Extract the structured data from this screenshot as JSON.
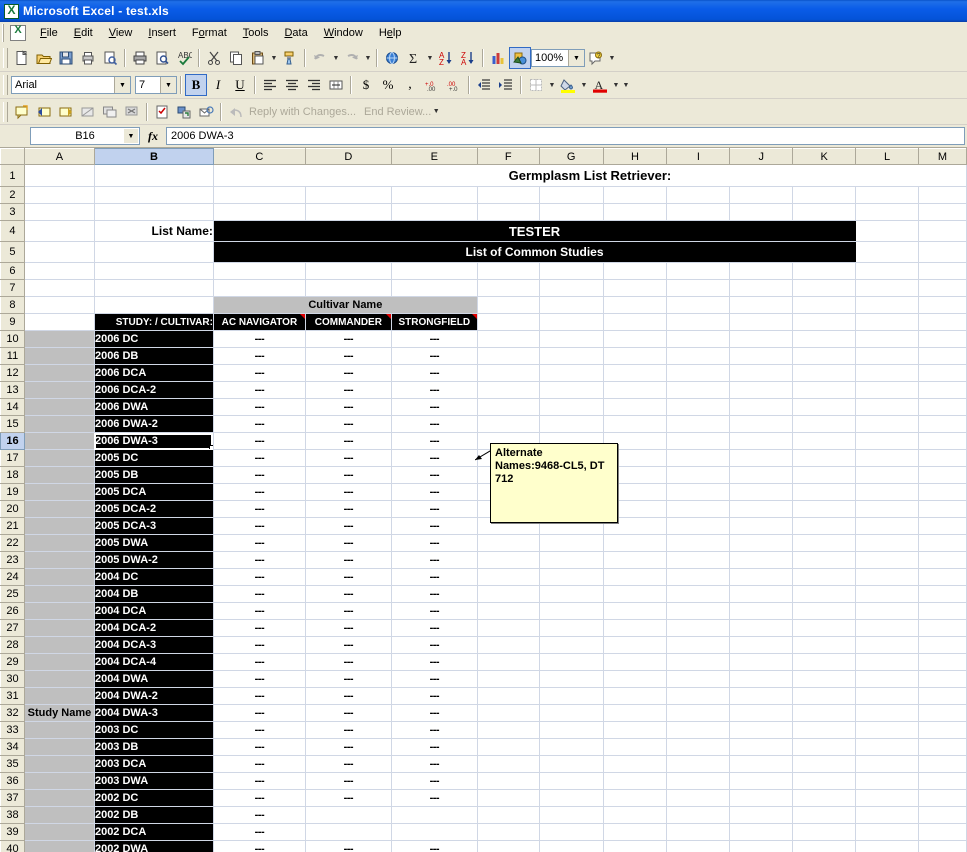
{
  "window": {
    "title": "Microsoft Excel - test.xls",
    "app_icon": "excel-icon"
  },
  "menu": {
    "items": [
      {
        "label": "File"
      },
      {
        "label": "Edit"
      },
      {
        "label": "View"
      },
      {
        "label": "Insert"
      },
      {
        "label": "Format"
      },
      {
        "label": "Tools"
      },
      {
        "label": "Data"
      },
      {
        "label": "Window"
      },
      {
        "label": "Help"
      }
    ]
  },
  "standard_toolbar": {
    "icons": [
      "new-icon",
      "open-icon",
      "save-icon",
      "print-icon",
      "print-preview-search-icon",
      "print2-icon",
      "preview-icon",
      "spelling-icon",
      "cut-icon",
      "copy-icon",
      "paste-icon",
      "format-painter-icon",
      "undo-icon",
      "redo-icon",
      "hyperlink-icon",
      "autosum-icon",
      "sort-asc-icon",
      "sort-desc-icon",
      "chart-wizard-icon",
      "drawing-icon",
      "help-icon"
    ],
    "zoom_value": "100%"
  },
  "formatting_toolbar": {
    "font_name": "Arial",
    "font_size": "7",
    "bold_label": "B",
    "italic_label": "I",
    "underline_label": "U",
    "icons": [
      "align-left-icon",
      "align-center-icon",
      "align-right-icon",
      "merge-center-icon",
      "currency-icon",
      "percent-icon",
      "comma-icon",
      "increase-decimal-icon",
      "decrease-decimal-icon",
      "decrease-indent-icon",
      "increase-indent-icon",
      "borders-icon",
      "fill-color-icon",
      "font-color-icon"
    ],
    "currency_label": "$",
    "percent_label": "%",
    "comma_label": ","
  },
  "reviewing_toolbar": {
    "icons": [
      "new-comment-icon",
      "previous-comment-icon",
      "next-comment-icon",
      "hide-comment-icon",
      "show-all-comments-icon",
      "delete-comment-icon",
      "create-task-icon",
      "update-file-icon",
      "send-to-mail-icon",
      "reply-icon"
    ],
    "reply_label": "Reply with Changes...",
    "end_review_label": "End Review..."
  },
  "formula_bar": {
    "name_box": "B16",
    "fx_label": "fx",
    "formula_value": "2006 DWA-3"
  },
  "sheet": {
    "columns": [
      "A",
      "B",
      "C",
      "D",
      "E",
      "F",
      "G",
      "H",
      "I",
      "J",
      "K",
      "L",
      "M"
    ],
    "selected_column": "B",
    "selected_row": 16,
    "selected_cell": "B16",
    "title_row1": "Germplasm List Retriever:",
    "list_name_label": "List Name:",
    "tester_title": "TESTER",
    "tester_subtitle": "List of Common Studies",
    "cultivar_group_header": "Cultivar Name",
    "study_cultivar_header": "STUDY: / CULTIVAR:",
    "study_name_label": "Study Name",
    "cultivar_headers": [
      "AC NAVIGATOR",
      "COMMANDER",
      "STRONGFIELD"
    ],
    "dash_value": "---",
    "rows": [
      {
        "row": 10,
        "study": "2006 DC",
        "values": [
          "---",
          "---",
          "---"
        ]
      },
      {
        "row": 11,
        "study": "2006 DB",
        "values": [
          "---",
          "---",
          "---"
        ]
      },
      {
        "row": 12,
        "study": "2006 DCA",
        "values": [
          "---",
          "---",
          "---"
        ]
      },
      {
        "row": 13,
        "study": "2006 DCA-2",
        "values": [
          "---",
          "---",
          "---"
        ]
      },
      {
        "row": 14,
        "study": "2006 DWA",
        "values": [
          "---",
          "---",
          "---"
        ]
      },
      {
        "row": 15,
        "study": "2006 DWA-2",
        "values": [
          "---",
          "---",
          "---"
        ]
      },
      {
        "row": 16,
        "study": "2006 DWA-3",
        "values": [
          "---",
          "---",
          "---"
        ]
      },
      {
        "row": 17,
        "study": "2005 DC",
        "values": [
          "---",
          "---",
          "---"
        ]
      },
      {
        "row": 18,
        "study": "2005 DB",
        "values": [
          "---",
          "---",
          "---"
        ]
      },
      {
        "row": 19,
        "study": "2005 DCA",
        "values": [
          "---",
          "---",
          "---"
        ]
      },
      {
        "row": 20,
        "study": "2005 DCA-2",
        "values": [
          "---",
          "---",
          "---"
        ]
      },
      {
        "row": 21,
        "study": "2005 DCA-3",
        "values": [
          "---",
          "---",
          "---"
        ]
      },
      {
        "row": 22,
        "study": "2005 DWA",
        "values": [
          "---",
          "---",
          "---"
        ]
      },
      {
        "row": 23,
        "study": "2005 DWA-2",
        "values": [
          "---",
          "---",
          "---"
        ]
      },
      {
        "row": 24,
        "study": "2004 DC",
        "values": [
          "---",
          "---",
          "---"
        ]
      },
      {
        "row": 25,
        "study": "2004 DB",
        "values": [
          "---",
          "---",
          "---"
        ]
      },
      {
        "row": 26,
        "study": "2004 DCA",
        "values": [
          "---",
          "---",
          "---"
        ]
      },
      {
        "row": 27,
        "study": "2004 DCA-2",
        "values": [
          "---",
          "---",
          "---"
        ]
      },
      {
        "row": 28,
        "study": "2004 DCA-3",
        "values": [
          "---",
          "---",
          "---"
        ]
      },
      {
        "row": 29,
        "study": "2004 DCA-4",
        "values": [
          "---",
          "---",
          "---"
        ]
      },
      {
        "row": 30,
        "study": "2004 DWA",
        "values": [
          "---",
          "---",
          "---"
        ]
      },
      {
        "row": 31,
        "study": "2004 DWA-2",
        "values": [
          "---",
          "---",
          "---"
        ]
      },
      {
        "row": 32,
        "study": "2004 DWA-3",
        "values": [
          "---",
          "---",
          "---"
        ]
      },
      {
        "row": 33,
        "study": "2003 DC",
        "values": [
          "---",
          "---",
          "---"
        ]
      },
      {
        "row": 34,
        "study": "2003 DB",
        "values": [
          "---",
          "---",
          "---"
        ]
      },
      {
        "row": 35,
        "study": "2003 DCA",
        "values": [
          "---",
          "---",
          "---"
        ]
      },
      {
        "row": 36,
        "study": "2003 DWA",
        "values": [
          "---",
          "---",
          "---"
        ]
      },
      {
        "row": 37,
        "study": "2002 DC",
        "values": [
          "---",
          "---",
          "---"
        ]
      },
      {
        "row": 38,
        "study": "2002 DB",
        "values": [
          "---",
          "",
          ""
        ]
      },
      {
        "row": 39,
        "study": "2002 DCA",
        "values": [
          "---",
          "",
          ""
        ]
      },
      {
        "row": 40,
        "study": "2002 DWA",
        "values": [
          "---",
          "---",
          "---"
        ]
      }
    ]
  },
  "comment": {
    "text": "Alternate Names:9468-CL5, DT 712"
  },
  "colors": {
    "titlebar": "#0a5ce8",
    "toolbar": "#ece9d8",
    "header_black": "#000000",
    "group_gray": "#bfbfbf",
    "comment_yellow": "#ffffcc",
    "comment_marker_red": "#e00000",
    "selection_blue": "#c1d2ee"
  }
}
